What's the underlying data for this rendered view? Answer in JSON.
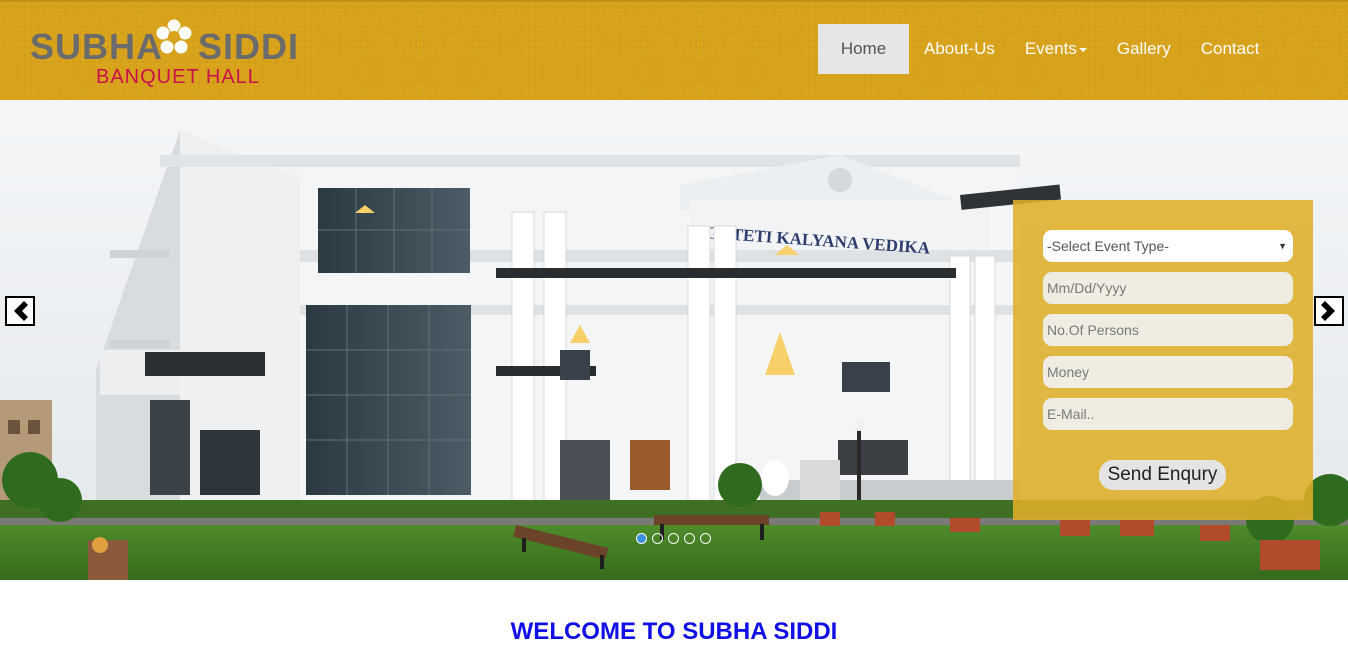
{
  "brand": {
    "name_left": "SUBHA",
    "name_right": "SIDDI",
    "subtitle": "BANQUET HALL",
    "logo_icon": "flower-icon"
  },
  "nav": {
    "items": [
      {
        "label": "Home",
        "active": true
      },
      {
        "label": "About-Us",
        "active": false
      },
      {
        "label": "Events",
        "active": false,
        "dropdown": true
      },
      {
        "label": "Gallery",
        "active": false
      },
      {
        "label": "Contact",
        "active": false
      }
    ]
  },
  "hero": {
    "building_sign": "GOTETI KALYANA VEDIKA",
    "slide_count": 5,
    "active_slide": 1,
    "prev_icon": "chevron-left-icon",
    "next_icon": "chevron-right-icon"
  },
  "enquiry": {
    "event_type_selected": "-Select Event Type-",
    "date_placeholder": "Mm/Dd/Yyyy",
    "persons_placeholder": "No.Of Persons",
    "money_placeholder": "Money",
    "email_placeholder": "E-Mail..",
    "submit_label": "Send Enqury"
  },
  "welcome": {
    "heading": "WELCOME TO SUBHA SIDDI"
  },
  "colors": {
    "header_bg": "#d8a21a",
    "form_bg": "#deaf28",
    "welcome_text": "#1010e6",
    "brand_sub": "#c8104a",
    "brand_grey": "#6b6b6b"
  }
}
